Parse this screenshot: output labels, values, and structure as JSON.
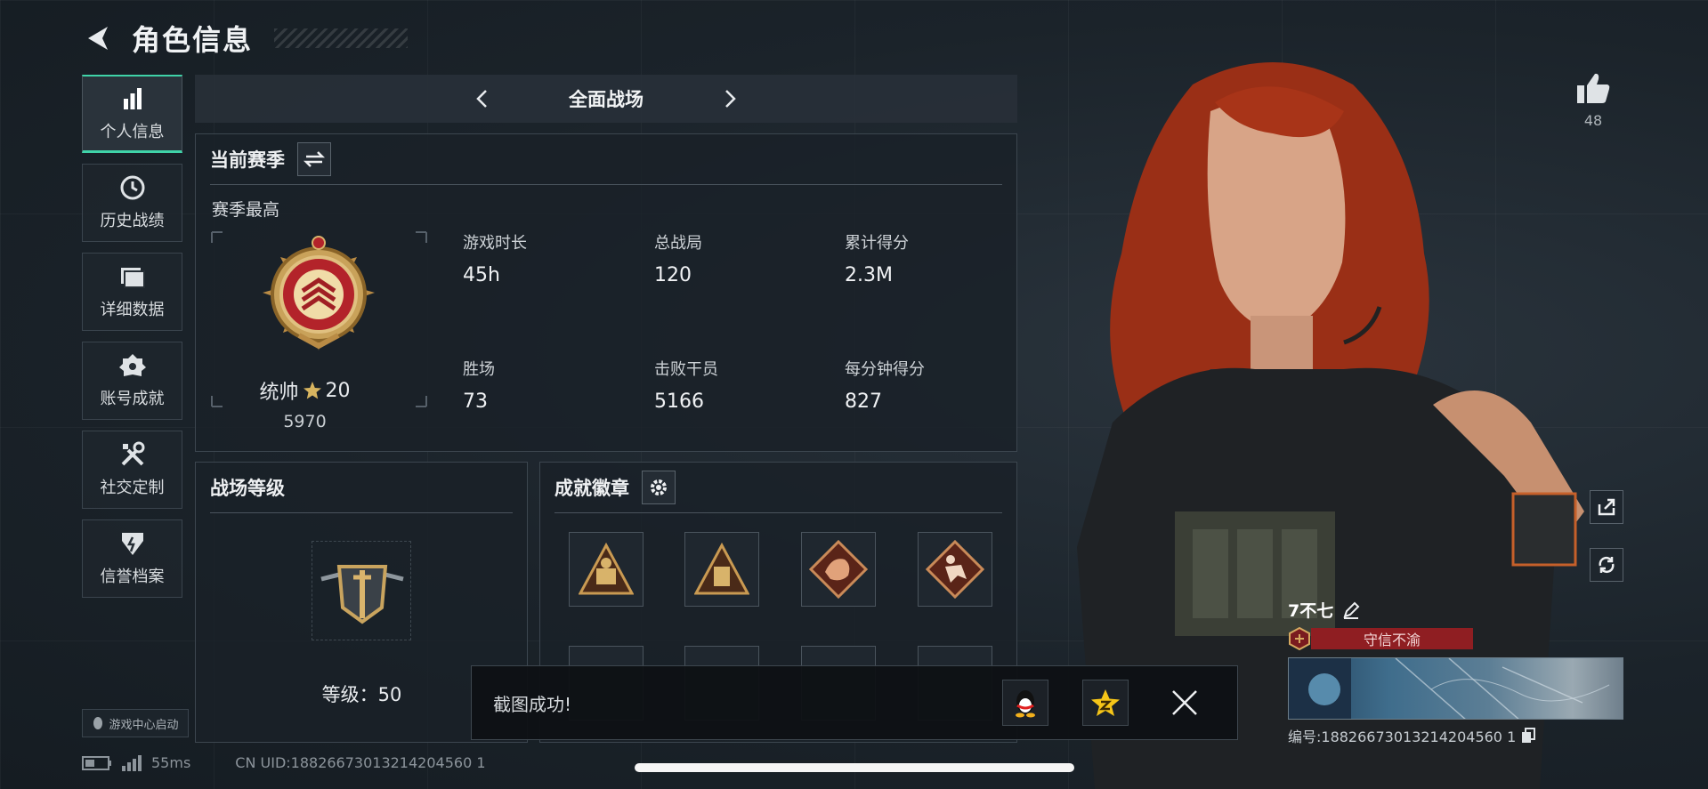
{
  "header": {
    "title": "角色信息"
  },
  "sidebar": {
    "items": [
      {
        "label": "个人信息",
        "icon": "bar-chart-icon",
        "active": true
      },
      {
        "label": "历史战绩",
        "icon": "clock-icon"
      },
      {
        "label": "详细数据",
        "icon": "folder-icon"
      },
      {
        "label": "账号成就",
        "icon": "medal-icon"
      },
      {
        "label": "社交定制",
        "icon": "tools-icon"
      },
      {
        "label": "信誉档案",
        "icon": "shield-icon"
      }
    ],
    "launch": "游戏中心启动"
  },
  "mode": {
    "name": "全面战场"
  },
  "season": {
    "title": "当前赛季",
    "best_label": "赛季最高",
    "rank_name": "统帅",
    "rank_stars": "20",
    "rank_score": "5970",
    "stats": [
      {
        "label": "游戏时长",
        "value": "45h"
      },
      {
        "label": "总战局",
        "value": "120"
      },
      {
        "label": "累计得分",
        "value": "2.3M"
      },
      {
        "label": "胜场",
        "value": "73"
      },
      {
        "label": "击败干员",
        "value": "5166"
      },
      {
        "label": "每分钟得分",
        "value": "827"
      }
    ]
  },
  "battlefield_level": {
    "title": "战场等级",
    "level_text": "等级：50"
  },
  "achievements": {
    "title": "成就徽章"
  },
  "toast": {
    "message": "截图成功!"
  },
  "status": {
    "ping": "55ms",
    "uid": "CN UID:18826673013214204560 1"
  },
  "likes": {
    "count": "48"
  },
  "player": {
    "name": "7不七",
    "honor": "守信不渝",
    "id_line": "编号:18826673013214204560 1"
  },
  "colors": {
    "accent": "#3fd3a8",
    "honor": "#8f1e22"
  }
}
